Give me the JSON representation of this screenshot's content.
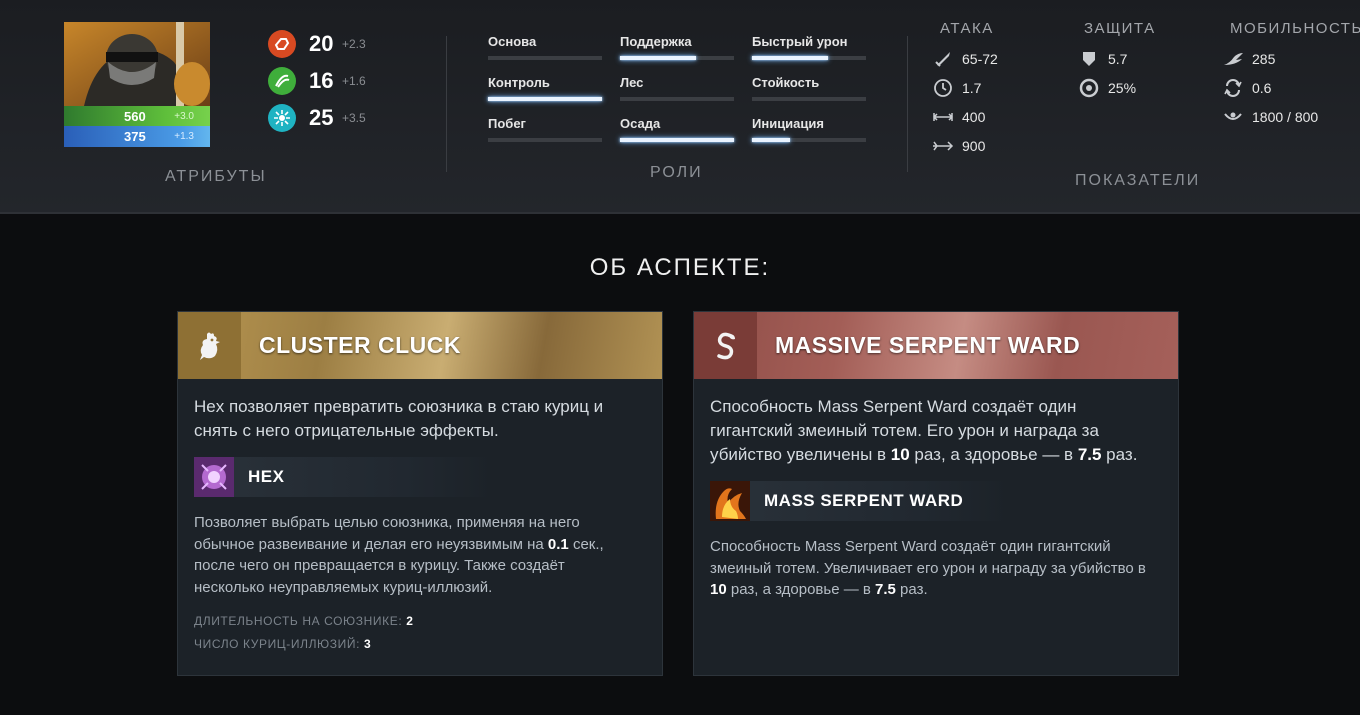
{
  "hero": {
    "health": "560",
    "health_regen": "+3.0",
    "mana": "375",
    "mana_regen": "+1.3"
  },
  "attributes": {
    "label": "АТРИБУТЫ",
    "items": [
      {
        "icon": "strength-icon",
        "value": "20",
        "gain": "+2.3",
        "color": "#d84a22"
      },
      {
        "icon": "agility-icon",
        "value": "16",
        "gain": "+1.6",
        "color": "#3fae3b"
      },
      {
        "icon": "intelligence-icon",
        "value": "25",
        "gain": "+3.5",
        "color": "#1fb3c2"
      }
    ]
  },
  "roles": {
    "label": "РОЛИ",
    "items": [
      {
        "name": "Основа",
        "level": 0
      },
      {
        "name": "Поддержка",
        "level": 0.67
      },
      {
        "name": "Быстрый урон",
        "level": 0.67
      },
      {
        "name": "Контроль",
        "level": 1.0
      },
      {
        "name": "Лес",
        "level": 0
      },
      {
        "name": "Стойкость",
        "level": 0
      },
      {
        "name": "Побег",
        "level": 0
      },
      {
        "name": "Осада",
        "level": 1.0
      },
      {
        "name": "Инициация",
        "level": 0.33
      }
    ]
  },
  "stats": {
    "label": "ПОКАЗАТЕЛИ",
    "attack": {
      "title": "АТАКА",
      "items": [
        {
          "icon": "damage-icon",
          "value": "65-72"
        },
        {
          "icon": "attack-time-icon",
          "value": "1.7"
        },
        {
          "icon": "attack-range-icon",
          "value": "400"
        },
        {
          "icon": "projectile-speed-icon",
          "value": "900"
        }
      ]
    },
    "defense": {
      "title": "ЗАЩИТА",
      "items": [
        {
          "icon": "armor-icon",
          "value": "5.7"
        },
        {
          "icon": "magic-resist-icon",
          "value": "25%"
        }
      ]
    },
    "mobility": {
      "title": "МОБИЛЬНОСТЬ",
      "items": [
        {
          "icon": "move-speed-icon",
          "value": "285"
        },
        {
          "icon": "turn-rate-icon",
          "value": "0.6"
        },
        {
          "icon": "vision-icon",
          "value": "1800 / 800"
        }
      ]
    }
  },
  "facets": {
    "title": "ОБ АСПЕКТЕ:",
    "cards": [
      {
        "color": "#b99752",
        "icon": "chicken-icon",
        "name": "CLUSTER CLUCK",
        "desc": "Hex позволяет превратить союзника в стаю куриц и снять с него отрицательные эффекты.",
        "ability": {
          "icon": "hex-icon",
          "name": "HEX",
          "desc_parts": [
            "Позволяет выбрать целью союзника, применяя на него обычное развеивание и делая его неуязвимым на ",
            "0.1",
            " сек., после чего он превращается в курицу. Также создаёт несколько неуправляемых куриц-иллюзий."
          ]
        },
        "values": [
          {
            "label": "ДЛИТЕЛЬНОСТЬ НА СОЮЗНИКЕ:",
            "value": "2"
          },
          {
            "label": "ЧИСЛО КУРИЦ-ИЛЛЮЗИЙ:",
            "value": "3"
          }
        ]
      },
      {
        "color": "#a35e57",
        "icon": "serpent-icon",
        "name": "MASSIVE SERPENT WARD",
        "desc_parts": [
          "Способность Mass Serpent Ward создаёт один гигантский змеиный тотем. Его урон и награда за убийство увеличены в ",
          "10",
          " раз, а здоровье — в ",
          "7.5",
          " раз."
        ],
        "ability": {
          "icon": "mass-serpent-ward-icon",
          "name": "MASS SERPENT WARD",
          "desc_parts": [
            "Способность Mass Serpent Ward создаёт один гигантский змеиный тотем. Увеличивает его урон и награду за убийство в ",
            "10",
            " раз, а здоровье — в ",
            "7.5",
            " раз."
          ]
        }
      }
    ]
  }
}
